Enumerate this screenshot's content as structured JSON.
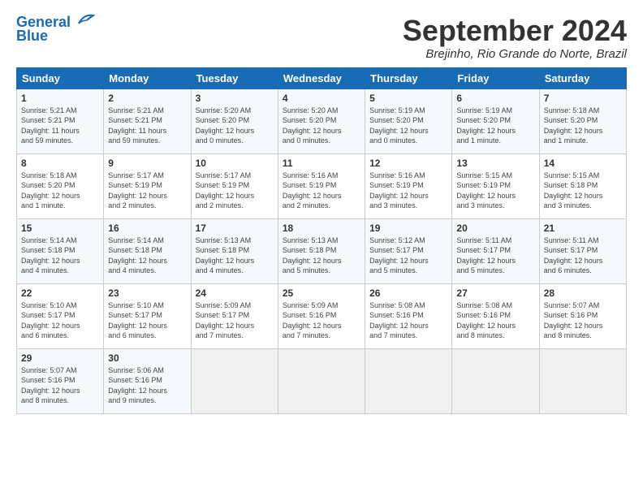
{
  "header": {
    "logo_line1": "General",
    "logo_line2": "Blue",
    "title": "September 2024",
    "location": "Brejinho, Rio Grande do Norte, Brazil"
  },
  "weekdays": [
    "Sunday",
    "Monday",
    "Tuesday",
    "Wednesday",
    "Thursday",
    "Friday",
    "Saturday"
  ],
  "weeks": [
    [
      {
        "day": "1",
        "content": "Sunrise: 5:21 AM\nSunset: 5:21 PM\nDaylight: 11 hours\nand 59 minutes."
      },
      {
        "day": "2",
        "content": "Sunrise: 5:21 AM\nSunset: 5:21 PM\nDaylight: 11 hours\nand 59 minutes."
      },
      {
        "day": "3",
        "content": "Sunrise: 5:20 AM\nSunset: 5:20 PM\nDaylight: 12 hours\nand 0 minutes."
      },
      {
        "day": "4",
        "content": "Sunrise: 5:20 AM\nSunset: 5:20 PM\nDaylight: 12 hours\nand 0 minutes."
      },
      {
        "day": "5",
        "content": "Sunrise: 5:19 AM\nSunset: 5:20 PM\nDaylight: 12 hours\nand 0 minutes."
      },
      {
        "day": "6",
        "content": "Sunrise: 5:19 AM\nSunset: 5:20 PM\nDaylight: 12 hours\nand 1 minute."
      },
      {
        "day": "7",
        "content": "Sunrise: 5:18 AM\nSunset: 5:20 PM\nDaylight: 12 hours\nand 1 minute."
      }
    ],
    [
      {
        "day": "8",
        "content": "Sunrise: 5:18 AM\nSunset: 5:20 PM\nDaylight: 12 hours\nand 1 minute."
      },
      {
        "day": "9",
        "content": "Sunrise: 5:17 AM\nSunset: 5:19 PM\nDaylight: 12 hours\nand 2 minutes."
      },
      {
        "day": "10",
        "content": "Sunrise: 5:17 AM\nSunset: 5:19 PM\nDaylight: 12 hours\nand 2 minutes."
      },
      {
        "day": "11",
        "content": "Sunrise: 5:16 AM\nSunset: 5:19 PM\nDaylight: 12 hours\nand 2 minutes."
      },
      {
        "day": "12",
        "content": "Sunrise: 5:16 AM\nSunset: 5:19 PM\nDaylight: 12 hours\nand 3 minutes."
      },
      {
        "day": "13",
        "content": "Sunrise: 5:15 AM\nSunset: 5:19 PM\nDaylight: 12 hours\nand 3 minutes."
      },
      {
        "day": "14",
        "content": "Sunrise: 5:15 AM\nSunset: 5:18 PM\nDaylight: 12 hours\nand 3 minutes."
      }
    ],
    [
      {
        "day": "15",
        "content": "Sunrise: 5:14 AM\nSunset: 5:18 PM\nDaylight: 12 hours\nand 4 minutes."
      },
      {
        "day": "16",
        "content": "Sunrise: 5:14 AM\nSunset: 5:18 PM\nDaylight: 12 hours\nand 4 minutes."
      },
      {
        "day": "17",
        "content": "Sunrise: 5:13 AM\nSunset: 5:18 PM\nDaylight: 12 hours\nand 4 minutes."
      },
      {
        "day": "18",
        "content": "Sunrise: 5:13 AM\nSunset: 5:18 PM\nDaylight: 12 hours\nand 5 minutes."
      },
      {
        "day": "19",
        "content": "Sunrise: 5:12 AM\nSunset: 5:17 PM\nDaylight: 12 hours\nand 5 minutes."
      },
      {
        "day": "20",
        "content": "Sunrise: 5:11 AM\nSunset: 5:17 PM\nDaylight: 12 hours\nand 5 minutes."
      },
      {
        "day": "21",
        "content": "Sunrise: 5:11 AM\nSunset: 5:17 PM\nDaylight: 12 hours\nand 6 minutes."
      }
    ],
    [
      {
        "day": "22",
        "content": "Sunrise: 5:10 AM\nSunset: 5:17 PM\nDaylight: 12 hours\nand 6 minutes."
      },
      {
        "day": "23",
        "content": "Sunrise: 5:10 AM\nSunset: 5:17 PM\nDaylight: 12 hours\nand 6 minutes."
      },
      {
        "day": "24",
        "content": "Sunrise: 5:09 AM\nSunset: 5:17 PM\nDaylight: 12 hours\nand 7 minutes."
      },
      {
        "day": "25",
        "content": "Sunrise: 5:09 AM\nSunset: 5:16 PM\nDaylight: 12 hours\nand 7 minutes."
      },
      {
        "day": "26",
        "content": "Sunrise: 5:08 AM\nSunset: 5:16 PM\nDaylight: 12 hours\nand 7 minutes."
      },
      {
        "day": "27",
        "content": "Sunrise: 5:08 AM\nSunset: 5:16 PM\nDaylight: 12 hours\nand 8 minutes."
      },
      {
        "day": "28",
        "content": "Sunrise: 5:07 AM\nSunset: 5:16 PM\nDaylight: 12 hours\nand 8 minutes."
      }
    ],
    [
      {
        "day": "29",
        "content": "Sunrise: 5:07 AM\nSunset: 5:16 PM\nDaylight: 12 hours\nand 8 minutes."
      },
      {
        "day": "30",
        "content": "Sunrise: 5:06 AM\nSunset: 5:16 PM\nDaylight: 12 hours\nand 9 minutes."
      },
      {
        "day": "",
        "content": ""
      },
      {
        "day": "",
        "content": ""
      },
      {
        "day": "",
        "content": ""
      },
      {
        "day": "",
        "content": ""
      },
      {
        "day": "",
        "content": ""
      }
    ]
  ]
}
